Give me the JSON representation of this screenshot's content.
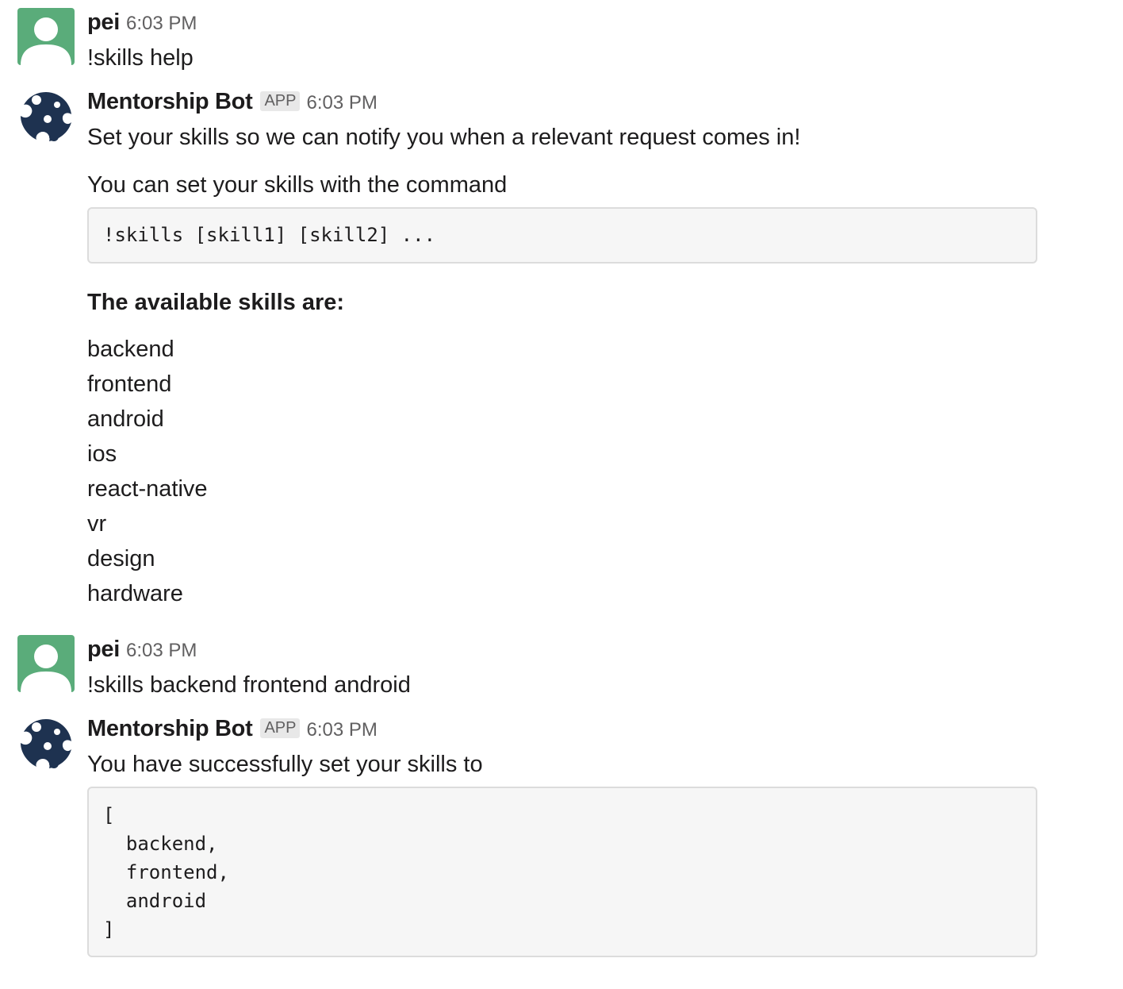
{
  "messages": {
    "m1": {
      "sender": "pei",
      "time": "6:03 PM",
      "text": "!skills help"
    },
    "m2": {
      "sender": "Mentorship Bot",
      "badge": "APP",
      "time": "6:03 PM",
      "line1": "Set your skills so we can notify you when a relevant request comes in!",
      "line2": "You can set your skills with the command",
      "code": "!skills [skill1] [skill2] ...",
      "skills_heading": "The available skills are:",
      "skills": [
        "backend",
        "frontend",
        "android",
        "ios",
        "react-native",
        "vr",
        "design",
        "hardware"
      ]
    },
    "m3": {
      "sender": "pei",
      "time": "6:03 PM",
      "text": "!skills backend frontend android"
    },
    "m4": {
      "sender": "Mentorship Bot",
      "badge": "APP",
      "time": "6:03 PM",
      "text": "You have successfully set your skills to",
      "code_lines": [
        "[",
        "  backend,",
        "  frontend,",
        "  android",
        "]"
      ]
    }
  },
  "colors": {
    "user_avatar_bg": "#5aac7a",
    "bot_logo": "#1e3250",
    "code_bg": "#f6f6f6"
  },
  "icons": {
    "user_avatar": "default-user-avatar-icon",
    "bot_avatar": "mentorship-bot-logo-icon"
  }
}
